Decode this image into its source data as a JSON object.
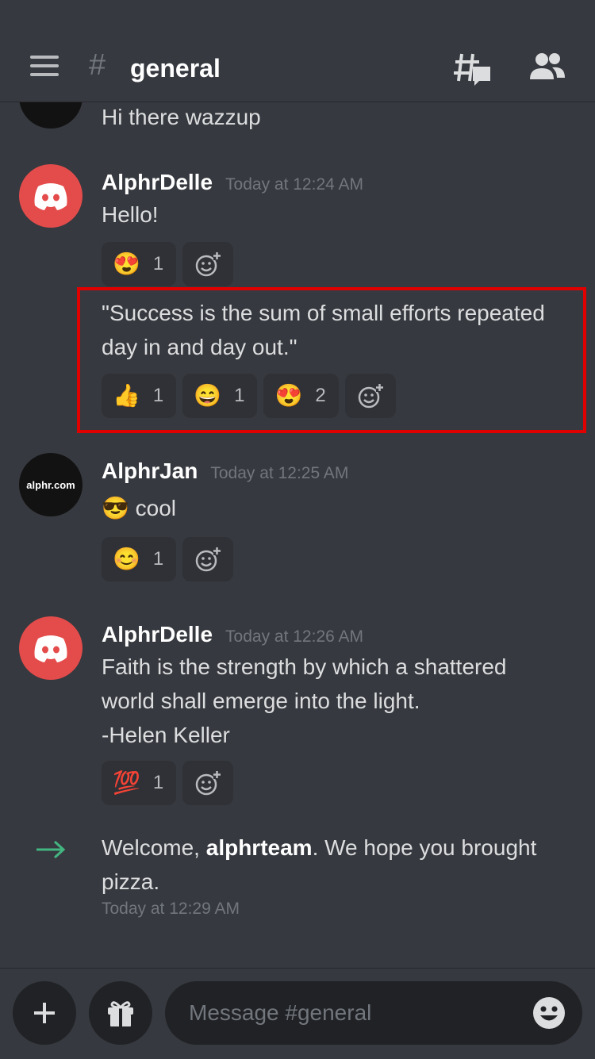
{
  "header": {
    "hash": "#",
    "channel": "general"
  },
  "messages": [
    {
      "text": "Hi there wazzup"
    },
    {
      "username": "AlphrDelle",
      "timestamp": "Today at 12:24 AM",
      "text": "Hello!",
      "reactions": [
        {
          "emoji": "😍",
          "count": "1"
        }
      ]
    },
    {
      "text": "\"Success is the sum of small efforts repeated day in and day out.\"",
      "reactions": [
        {
          "emoji": "👍",
          "count": "1"
        },
        {
          "emoji": "😄",
          "count": "1"
        },
        {
          "emoji": "😍",
          "count": "2"
        }
      ]
    },
    {
      "username": "AlphrJan",
      "avatar_text": "alphr.com",
      "timestamp": "Today at 12:25 AM",
      "emoji": "😎",
      "text": "cool",
      "reactions": [
        {
          "emoji": "😊",
          "count": "1"
        }
      ]
    },
    {
      "username": "AlphrDelle",
      "timestamp": "Today at 12:26 AM",
      "lines": [
        "Faith is the strength by which a shattered",
        "world shall emerge into the light.",
        "-Helen Keller"
      ],
      "reactions": [
        {
          "emoji": "💯",
          "count": "1"
        }
      ]
    }
  ],
  "welcome": {
    "prefix": "Welcome, ",
    "user": "alphrteam",
    "suffix": ". We hope you brought pizza.",
    "timestamp": "Today at 12:29 AM"
  },
  "composer": {
    "placeholder": "Message #general"
  },
  "colors": {
    "accent_red": "#e44c4b",
    "highlight": "#e00000",
    "join_arrow": "#43b581"
  }
}
